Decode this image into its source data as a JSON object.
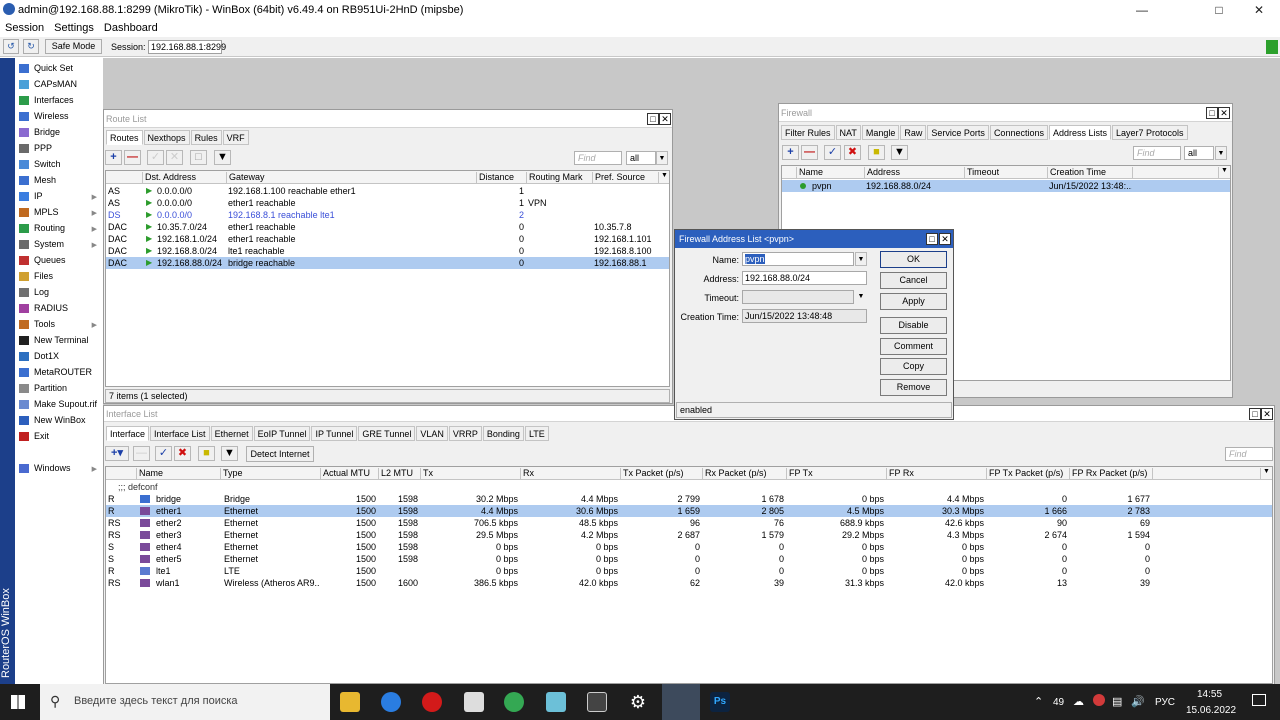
{
  "window": {
    "title": "admin@192.168.88.1:8299 (MikroTik) - WinBox (64bit) v6.49.4 on RB951Ui-2HnD (mipsbe)"
  },
  "menu": [
    "Session",
    "Settings",
    "Dashboard"
  ],
  "toolbar": {
    "safe_mode": "Safe Mode",
    "session_label": "Session:",
    "session_value": "192.168.88.1:8299"
  },
  "side_label": "RouterOS WinBox",
  "sidebar": [
    {
      "label": "Quick Set",
      "icon": "quickset-icon",
      "arrow": false
    },
    {
      "label": "CAPsMAN",
      "icon": "capsman-icon",
      "arrow": false
    },
    {
      "label": "Interfaces",
      "icon": "interfaces-icon",
      "arrow": false
    },
    {
      "label": "Wireless",
      "icon": "wireless-icon",
      "arrow": false
    },
    {
      "label": "Bridge",
      "icon": "bridge-icon",
      "arrow": false
    },
    {
      "label": "PPP",
      "icon": "ppp-icon",
      "arrow": false
    },
    {
      "label": "Switch",
      "icon": "switch-icon",
      "arrow": false
    },
    {
      "label": "Mesh",
      "icon": "mesh-icon",
      "arrow": false
    },
    {
      "label": "IP",
      "icon": "ip-icon",
      "arrow": true
    },
    {
      "label": "MPLS",
      "icon": "mpls-icon",
      "arrow": true
    },
    {
      "label": "Routing",
      "icon": "routing-icon",
      "arrow": true
    },
    {
      "label": "System",
      "icon": "system-icon",
      "arrow": true
    },
    {
      "label": "Queues",
      "icon": "queues-icon",
      "arrow": false
    },
    {
      "label": "Files",
      "icon": "files-icon",
      "arrow": false
    },
    {
      "label": "Log",
      "icon": "log-icon",
      "arrow": false
    },
    {
      "label": "RADIUS",
      "icon": "radius-icon",
      "arrow": false
    },
    {
      "label": "Tools",
      "icon": "tools-icon",
      "arrow": true
    },
    {
      "label": "New Terminal",
      "icon": "terminal-icon",
      "arrow": false
    },
    {
      "label": "Dot1X",
      "icon": "dot1x-icon",
      "arrow": false
    },
    {
      "label": "MetaROUTER",
      "icon": "metarouter-icon",
      "arrow": false
    },
    {
      "label": "Partition",
      "icon": "partition-icon",
      "arrow": false
    },
    {
      "label": "Make Supout.rif",
      "icon": "supout-icon",
      "arrow": false
    },
    {
      "label": "New WinBox",
      "icon": "winbox-icon",
      "arrow": false
    },
    {
      "label": "Exit",
      "icon": "exit-icon",
      "arrow": false
    },
    {
      "label": "Windows",
      "icon": "windows-icon",
      "arrow": true
    }
  ],
  "route_list": {
    "title": "Route List",
    "tabs": [
      "Routes",
      "Nexthops",
      "Rules",
      "VRF"
    ],
    "find": "Find",
    "filter": "all",
    "columns": [
      "Dst. Address",
      "Gateway",
      "Distance",
      "Routing Mark",
      "Pref. Source"
    ],
    "rows": [
      {
        "flags": "AS",
        "dst": "0.0.0.0/0",
        "gw": "192.168.1.100 reachable ether1",
        "dist": "1",
        "mark": "",
        "pref": ""
      },
      {
        "flags": "AS",
        "dst": "0.0.0.0/0",
        "gw": "ether1 reachable",
        "dist": "1",
        "mark": "VPN",
        "pref": ""
      },
      {
        "flags": "DS",
        "dst": "0.0.0.0/0",
        "gw": "192.168.8.1 reachable lte1",
        "dist": "2",
        "mark": "",
        "pref": ""
      },
      {
        "flags": "DAC",
        "dst": "10.35.7.0/24",
        "gw": "ether1 reachable",
        "dist": "0",
        "mark": "",
        "pref": "10.35.7.8"
      },
      {
        "flags": "DAC",
        "dst": "192.168.1.0/24",
        "gw": "ether1 reachable",
        "dist": "0",
        "mark": "",
        "pref": "192.168.1.101"
      },
      {
        "flags": "DAC",
        "dst": "192.168.8.0/24",
        "gw": "lte1 reachable",
        "dist": "0",
        "mark": "",
        "pref": "192.168.8.100"
      },
      {
        "flags": "DAC",
        "dst": "192.168.88.0/24",
        "gw": "bridge reachable",
        "dist": "0",
        "mark": "",
        "pref": "192.168.88.1"
      }
    ],
    "status": "7 items (1 selected)"
  },
  "firewall": {
    "title": "Firewall",
    "tabs": [
      "Filter Rules",
      "NAT",
      "Mangle",
      "Raw",
      "Service Ports",
      "Connections",
      "Address Lists",
      "Layer7 Protocols"
    ],
    "find": "Find",
    "filter": "all",
    "columns": [
      "Name",
      "Address",
      "Timeout",
      "Creation Time"
    ],
    "rows": [
      {
        "name": "pvpn",
        "address": "192.168.88.0/24",
        "timeout": "",
        "created": "Jun/15/2022 13:48:..."
      }
    ]
  },
  "dialog": {
    "title": "Firewall Address List <pvpn>",
    "name_label": "Name:",
    "name": "pvpn",
    "address_label": "Address:",
    "address": "192.168.88.0/24",
    "timeout_label": "Timeout:",
    "timeout": "",
    "created_label": "Creation Time:",
    "created": "Jun/15/2022 13:48:48",
    "buttons": [
      "OK",
      "Cancel",
      "Apply",
      "Disable",
      "Comment",
      "Copy",
      "Remove"
    ],
    "status": "enabled"
  },
  "iface_list": {
    "title": "Interface List",
    "tabs": [
      "Interface",
      "Interface List",
      "Ethernet",
      "EoIP Tunnel",
      "IP Tunnel",
      "GRE Tunnel",
      "VLAN",
      "VRRP",
      "Bonding",
      "LTE"
    ],
    "detect": "Detect Internet",
    "find": "Find",
    "columns": [
      "Name",
      "Type",
      "Actual MTU",
      "L2 MTU",
      "Tx",
      "Rx",
      "Tx Packet (p/s)",
      "Rx Packet (p/s)",
      "FP Tx",
      "FP Rx",
      "FP Tx Packet (p/s)",
      "FP Rx Packet (p/s)"
    ],
    "comment": ";;; defconf",
    "rows": [
      {
        "flags": "R",
        "name": "bridge",
        "type": "Bridge",
        "mtu": "1500",
        "l2": "1598",
        "tx": "30.2 Mbps",
        "rx": "4.4 Mbps",
        "txp": "2 799",
        "rxp": "1 678",
        "fptx": "0 bps",
        "fprx": "4.4 Mbps",
        "fptxp": "0",
        "fprxp": "1 677"
      },
      {
        "flags": "R",
        "name": "ether1",
        "type": "Ethernet",
        "mtu": "1500",
        "l2": "1598",
        "tx": "4.4 Mbps",
        "rx": "30.6 Mbps",
        "txp": "1 659",
        "rxp": "2 805",
        "fptx": "4.5 Mbps",
        "fprx": "30.3 Mbps",
        "fptxp": "1 666",
        "fprxp": "2 783"
      },
      {
        "flags": "RS",
        "name": "ether2",
        "type": "Ethernet",
        "mtu": "1500",
        "l2": "1598",
        "tx": "706.5 kbps",
        "rx": "48.5 kbps",
        "txp": "96",
        "rxp": "76",
        "fptx": "688.9 kbps",
        "fprx": "42.6 kbps",
        "fptxp": "90",
        "fprxp": "69"
      },
      {
        "flags": "RS",
        "name": "ether3",
        "type": "Ethernet",
        "mtu": "1500",
        "l2": "1598",
        "tx": "29.5 Mbps",
        "rx": "4.2 Mbps",
        "txp": "2 687",
        "rxp": "1 579",
        "fptx": "29.2 Mbps",
        "fprx": "4.3 Mbps",
        "fptxp": "2 674",
        "fprxp": "1 594"
      },
      {
        "flags": "S",
        "name": "ether4",
        "type": "Ethernet",
        "mtu": "1500",
        "l2": "1598",
        "tx": "0 bps",
        "rx": "0 bps",
        "txp": "0",
        "rxp": "0",
        "fptx": "0 bps",
        "fprx": "0 bps",
        "fptxp": "0",
        "fprxp": "0"
      },
      {
        "flags": "S",
        "name": "ether5",
        "type": "Ethernet",
        "mtu": "1500",
        "l2": "1598",
        "tx": "0 bps",
        "rx": "0 bps",
        "txp": "0",
        "rxp": "0",
        "fptx": "0 bps",
        "fprx": "0 bps",
        "fptxp": "0",
        "fprxp": "0"
      },
      {
        "flags": "R",
        "name": "lte1",
        "type": "LTE",
        "mtu": "1500",
        "l2": "",
        "tx": "0 bps",
        "rx": "0 bps",
        "txp": "0",
        "rxp": "0",
        "fptx": "0 bps",
        "fprx": "0 bps",
        "fptxp": "0",
        "fprxp": "0"
      },
      {
        "flags": "RS",
        "name": "wlan1",
        "type": "Wireless (Atheros AR9...",
        "mtu": "1500",
        "l2": "1600",
        "tx": "386.5 kbps",
        "rx": "42.0 kbps",
        "txp": "62",
        "rxp": "39",
        "fptx": "31.3 kbps",
        "fprx": "42.0 kbps",
        "fptxp": "13",
        "fprxp": "39"
      }
    ]
  },
  "taskbar": {
    "search": "Введите здесь текст для поиска",
    "tray_num": "49",
    "lang": "РУС",
    "time": "14:55",
    "date": "15.06.2022"
  },
  "colors": {
    "sidebar_strip": "#1c3f8a",
    "selection": "#aecbf0",
    "disabled_route": "#3a4fd8"
  }
}
